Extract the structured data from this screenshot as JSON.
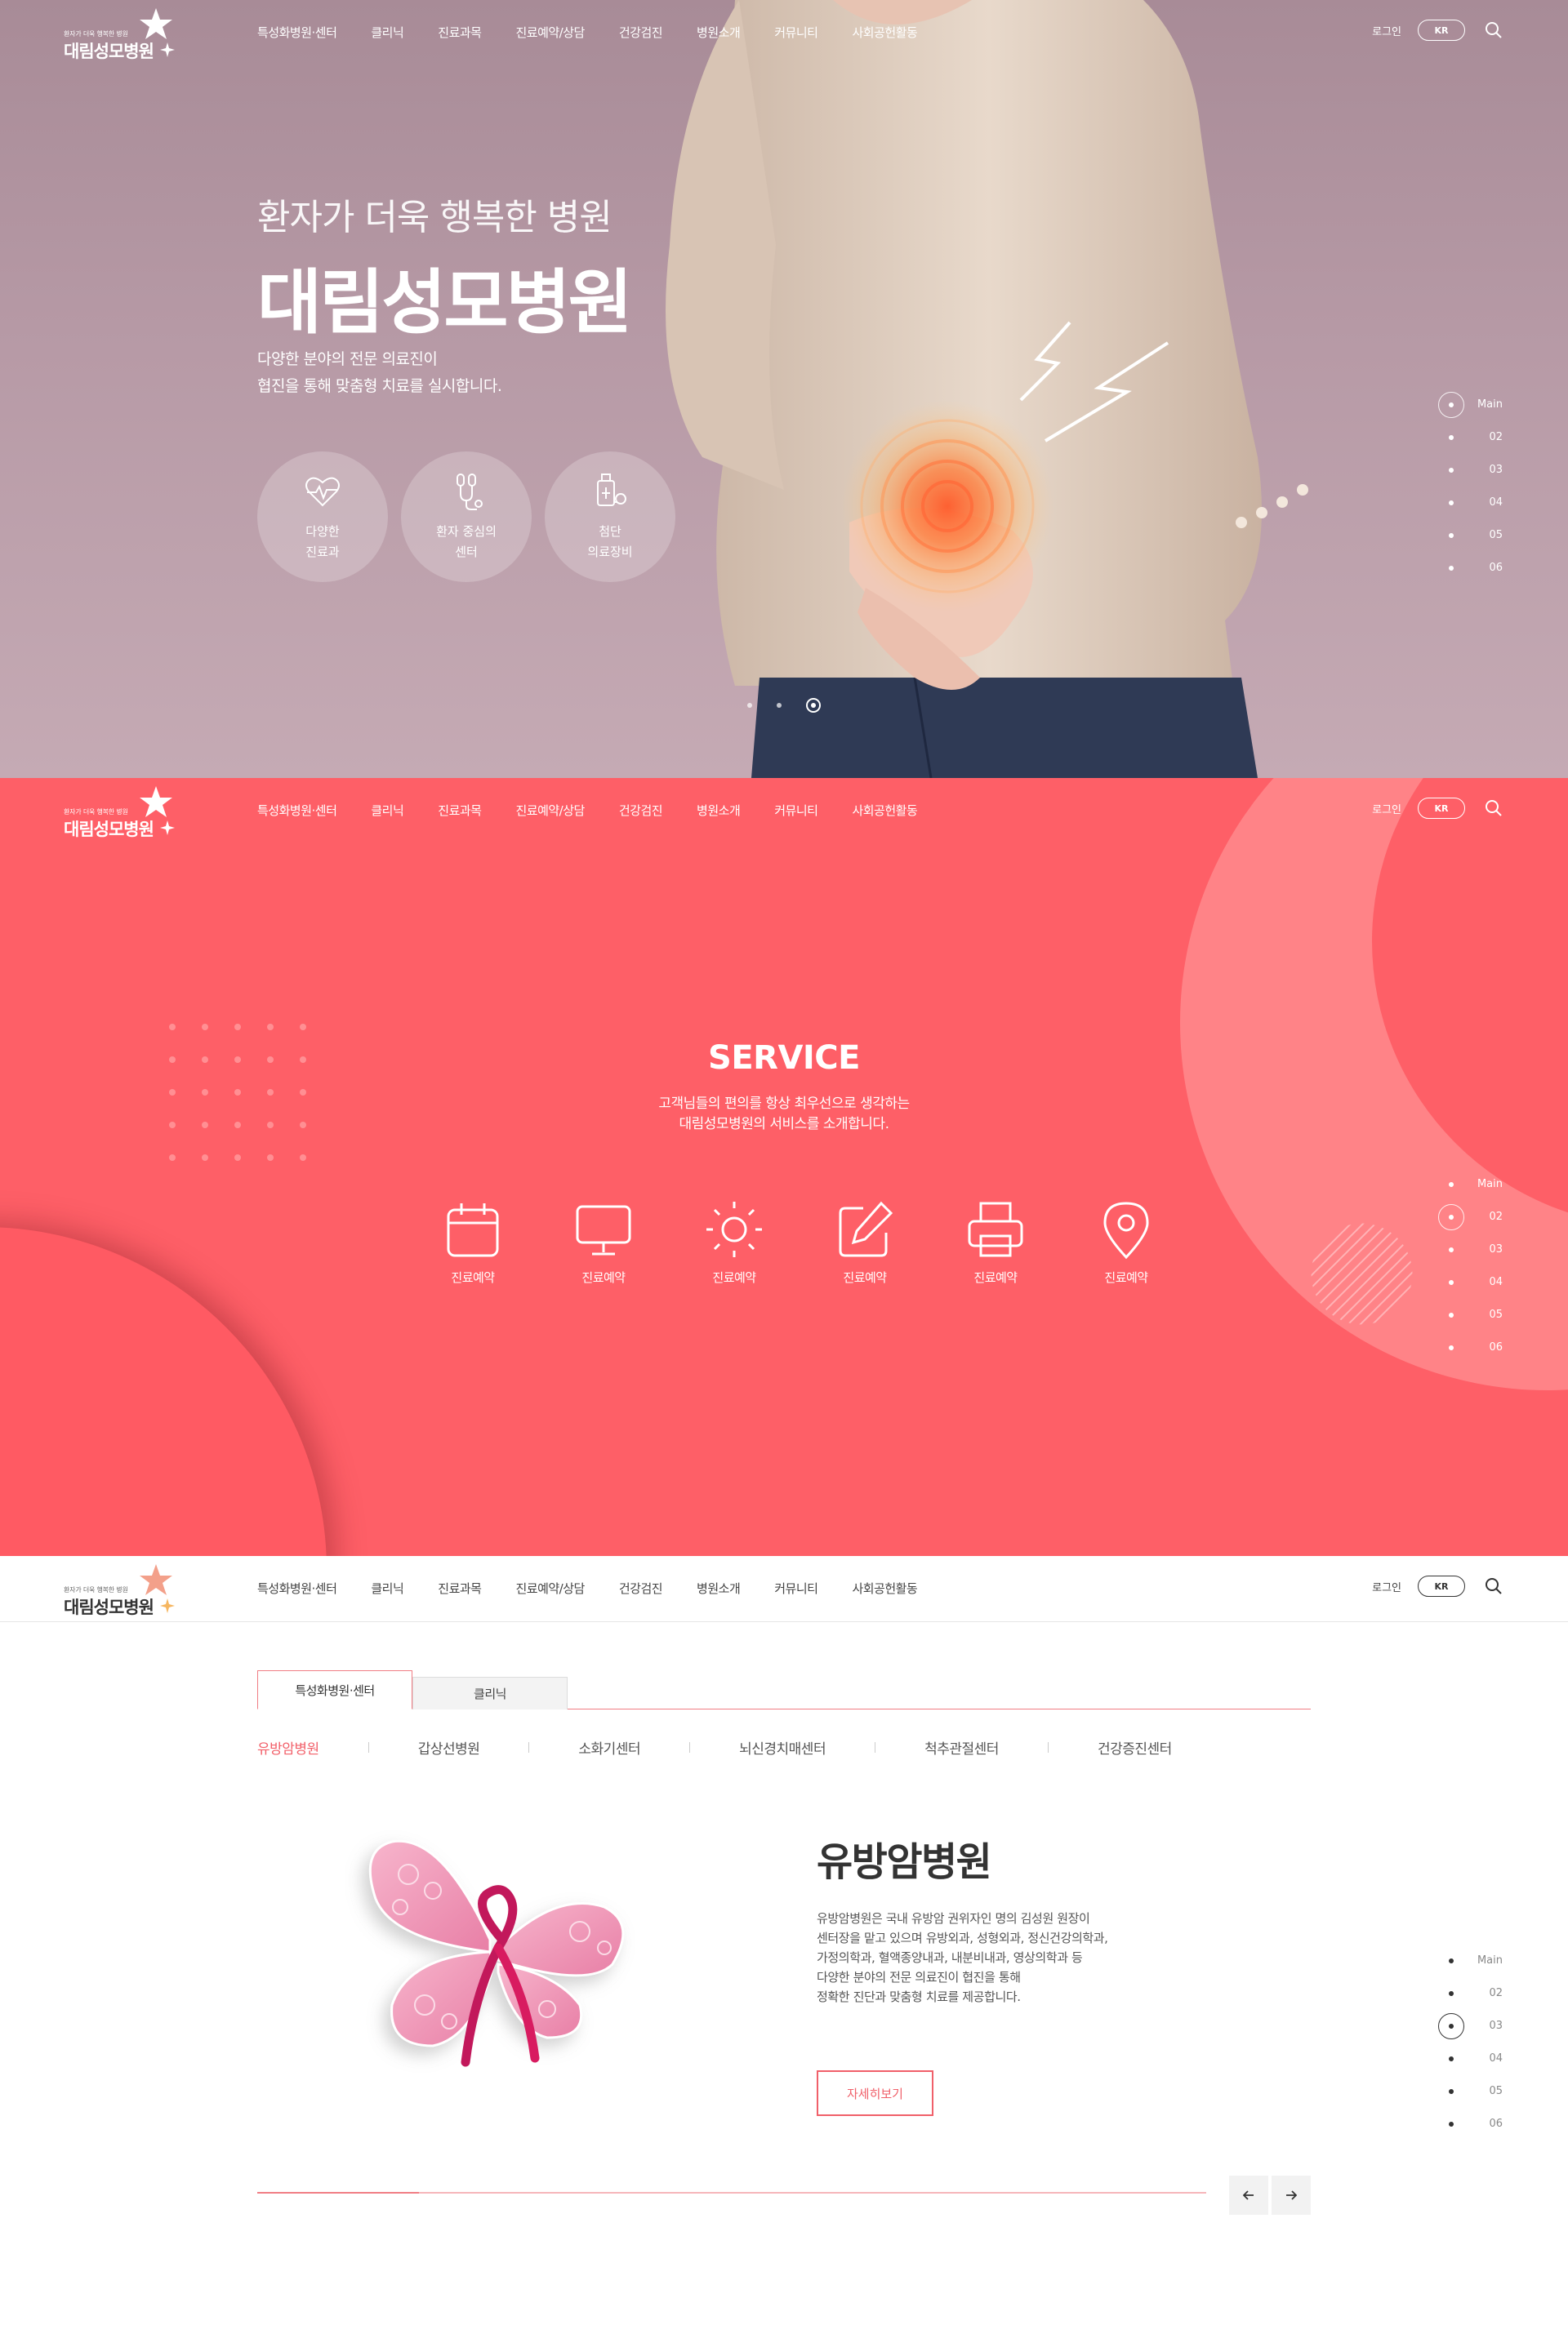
{
  "header": {
    "logo_slogan": "환자가 더욱 행복한 병원",
    "logo_name": "대림성모병원",
    "nav": [
      "특성화병원·센터",
      "클리닉",
      "진료과목",
      "진료예약/상담",
      "건강검진",
      "병원소개",
      "커뮤니티",
      "사회공헌활동"
    ],
    "login": "로그인",
    "lang": "KR"
  },
  "pager": [
    "Main",
    "02",
    "03",
    "04",
    "05",
    "06"
  ],
  "hero": {
    "subtitle": "환자가 더욱 행복한 병원",
    "title": "대림성모병원",
    "desc_line1": "다양한 분야의 전문 의료진이",
    "desc_line2": "협진을 통해 맞춤형 치료를 실시합니다.",
    "features": [
      {
        "line1": "다양한",
        "line2": "진료과",
        "icon": "heart-pulse-icon"
      },
      {
        "line1": "환자 중심의",
        "line2": "센터",
        "icon": "stethoscope-icon"
      },
      {
        "line1": "첨단",
        "line2": "의료장비",
        "icon": "medical-device-icon"
      }
    ],
    "slider_active": 3
  },
  "service": {
    "title": "SERVICE",
    "desc_line1": "고객님들의 편의를 항상 최우선으로 생각하는",
    "desc_line2": "대림성모병원의 서비스를 소개합니다.",
    "items": [
      {
        "label": "진료예약",
        "icon": "calendar-icon"
      },
      {
        "label": "진료예약",
        "icon": "monitor-icon"
      },
      {
        "label": "진료예약",
        "icon": "sun-icon"
      },
      {
        "label": "진료예약",
        "icon": "edit-icon"
      },
      {
        "label": "진료예약",
        "icon": "printer-icon"
      },
      {
        "label": "진료예약",
        "icon": "map-pin-icon"
      }
    ]
  },
  "center": {
    "tabs": [
      "특성화병원·센터",
      "클리닉"
    ],
    "subtabs": [
      "유방암병원",
      "갑상선병원",
      "소화기센터",
      "뇌신경치매센터",
      "척추관절센터",
      "건강증진센터"
    ],
    "title": "유방암병원",
    "desc": [
      "유방암병원은 국내 유방암 권위자인 명의 김성원 원장이",
      "센터장을 맡고 있으며 유방외과, 성형외과, 정신건강의학과,",
      "가정의학과, 혈액종양내과, 내분비내과, 영상의학과 등",
      "다양한 분야의 전문 의료진이 협진을 통해",
      "정확한 진단과 맞춤형 치료를 제공합니다."
    ],
    "more": "자세히보기",
    "progress": 0.17
  },
  "colors": {
    "brand_coral": "#fe5f67",
    "accent_pink": "#f0606a",
    "hero_mauve": "#b79aa6"
  }
}
